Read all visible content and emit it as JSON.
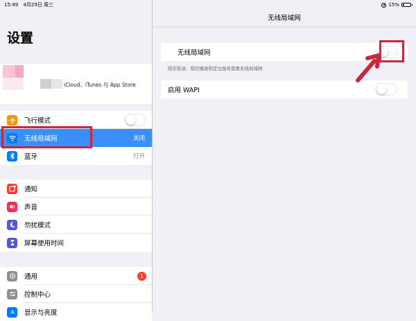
{
  "status": {
    "time": "15:49",
    "date": "4月29日 周三",
    "battery_text": "15%",
    "battery_level": 0.15
  },
  "sidebar": {
    "title": "设置",
    "profile_subtitle": "iCloud、iTunes 与 App Store",
    "group1": [
      {
        "label": "飞行模式",
        "icon": "airplane-icon",
        "color": "#ff9500",
        "value": ""
      },
      {
        "label": "无线局域网",
        "icon": "wifi-icon",
        "color": "#007aff",
        "value": "关闭",
        "selected": true
      },
      {
        "label": "蓝牙",
        "icon": "bluetooth-icon",
        "color": "#007aff",
        "value": "打开"
      }
    ],
    "group2": [
      {
        "label": "通知",
        "icon": "notifications-icon",
        "color": "#ff3b30"
      },
      {
        "label": "声音",
        "icon": "sound-icon",
        "color": "#ff2d55"
      },
      {
        "label": "勿扰模式",
        "icon": "moon-icon",
        "color": "#5856d6"
      },
      {
        "label": "屏幕使用时间",
        "icon": "hourglass-icon",
        "color": "#5856d6"
      }
    ],
    "group3": [
      {
        "label": "通用",
        "icon": "gear-icon",
        "color": "#8e8e93",
        "badge": "1"
      },
      {
        "label": "控制中心",
        "icon": "control-center-icon",
        "color": "#8e8e93"
      },
      {
        "label": "显示与亮度",
        "icon": "display-icon",
        "color": "#007aff"
      }
    ]
  },
  "main": {
    "title": "无线局域网",
    "wifi_label": "无线局域网",
    "wifi_on": false,
    "footnote": "隔空投送、隔空播放和定位服务需要无线局域网",
    "wapi_label": "启用 WAPI",
    "wapi_on": false
  },
  "colors": {
    "accent": "#3a8ffb",
    "annotation": "#c5293f",
    "background": "#efeff4"
  }
}
